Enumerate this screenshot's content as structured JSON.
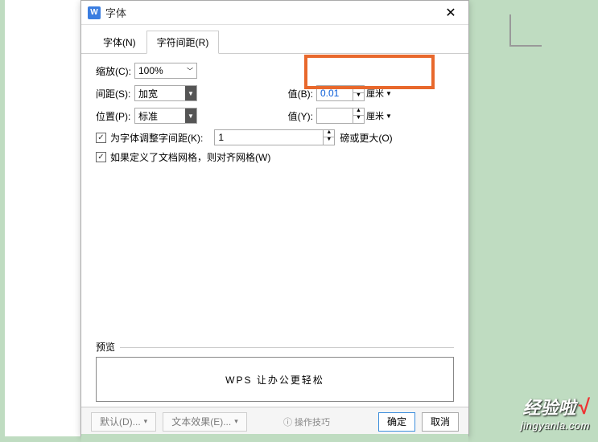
{
  "window": {
    "icon_text": "W",
    "title": "字体"
  },
  "tabs": {
    "font": "字体(N)",
    "spacing": "字符间距(R)"
  },
  "fields": {
    "scale_label": "缩放(C):",
    "scale_value": "100%",
    "spacing_label": "间距(S):",
    "spacing_value": "加宽",
    "value_b_label": "值(B):",
    "value_b_value": "0.01",
    "value_b_unit": "厘米",
    "position_label": "位置(P):",
    "position_value": "标准",
    "value_y_label": "值(Y):",
    "value_y_value": "",
    "value_y_unit": "厘米",
    "kerning_label": "为字体调整字间距(K):",
    "kerning_value": "1",
    "kerning_unit": "磅或更大(O)",
    "snap_label": "如果定义了文档网格，则对齐网格(W)"
  },
  "preview": {
    "label": "预览",
    "text": "WPS 让办公更轻松"
  },
  "footer": {
    "default_btn": "默认(D)...",
    "text_effect_btn": "文本效果(E)...",
    "ops_tip": "操作技巧",
    "ok_btn": "确定",
    "cancel_btn": "取消"
  },
  "watermark": {
    "brand": "经验啦",
    "check": "√",
    "url": "jingyanla.com"
  }
}
